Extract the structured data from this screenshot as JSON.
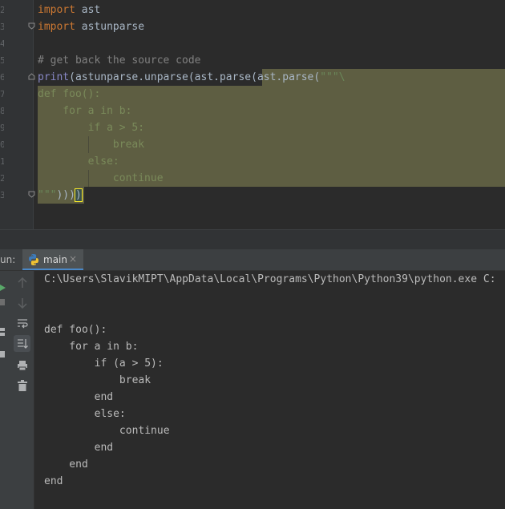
{
  "editor": {
    "line_numbers": [
      "2",
      "3",
      "4",
      "5",
      "6",
      "7",
      "8",
      "9",
      "0",
      "1",
      "2",
      "3"
    ],
    "lines": [
      [
        {
          "t": "import",
          "c": "kw"
        },
        {
          "t": " ast",
          "c": ""
        }
      ],
      [
        {
          "t": "import",
          "c": "kw"
        },
        {
          "t": " astunparse",
          "c": ""
        }
      ],
      [],
      [
        {
          "t": "# get back the source code",
          "c": "cmt"
        }
      ],
      [
        {
          "t": "print",
          "c": "fn"
        },
        {
          "t": "(astunparse.unparse(ast.parse(ast.parse(",
          "c": ""
        },
        {
          "t": "\"\"\"\\",
          "c": "str"
        }
      ],
      [
        {
          "t": "def foo():",
          "c": "dim"
        }
      ],
      [
        {
          "t": "    for a in b:",
          "c": "dim"
        }
      ],
      [
        {
          "t": "        if a > 5:",
          "c": "dim"
        }
      ],
      [
        {
          "t": "            break",
          "c": "dim"
        }
      ],
      [
        {
          "t": "        else:",
          "c": "dim"
        }
      ],
      [
        {
          "t": "            continue",
          "c": "dim"
        }
      ],
      [
        {
          "t": "\"\"\"",
          "c": "str"
        },
        {
          "t": ")))",
          "c": ""
        },
        {
          "t": ")",
          "c": "cursor-paren"
        }
      ]
    ]
  },
  "run_panel": {
    "label": "un:",
    "tab_label": "main",
    "tab_close": "×"
  },
  "console": {
    "lines": [
      "C:\\Users\\SlavikMIPT\\AppData\\Local\\Programs\\Python\\Python39\\python.exe C:",
      "",
      "",
      "def foo():",
      "    for a in b:",
      "        if (a > 5):",
      "            break",
      "        end",
      "        else:",
      "            continue",
      "        end",
      "    end",
      "end"
    ]
  },
  "icons": {
    "tools": [
      "arrow-up-icon",
      "arrow-down-icon",
      "soft-wrap-icon",
      "scroll-to-end-icon",
      "print-icon",
      "trash-icon"
    ],
    "left_strip": [
      "run-icon",
      "stop-icon",
      "layout-icon",
      "settings-icon"
    ]
  }
}
